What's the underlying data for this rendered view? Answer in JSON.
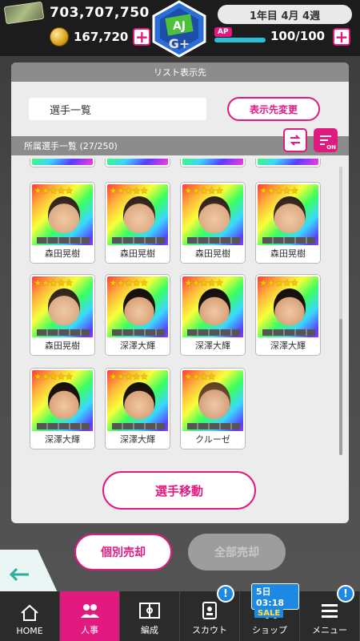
{
  "header": {
    "money": "703,707,750",
    "coins": "167,720",
    "date": "1年目 4月 4週",
    "ap_label": "AP",
    "ap_value": "100/100",
    "plus": "+"
  },
  "list_target": {
    "section_title": "リスト表示先",
    "current": "選手一覧",
    "change_button": "表示先変更"
  },
  "roster": {
    "section_title": "所属選手一覧 (27/250)",
    "filter_on": "ON",
    "cards": [
      {
        "name": "森田晃樹",
        "stars": "★★★★★",
        "face": "hair-long"
      },
      {
        "name": "森田晃樹",
        "stars": "★★★★★",
        "face": "hair-long"
      },
      {
        "name": "森田晃樹",
        "stars": "★★★★★",
        "face": "hair-long"
      },
      {
        "name": "森田晃樹",
        "stars": "★★★★★",
        "face": "hair-long"
      },
      {
        "name": "森田晃樹",
        "stars": "★★★★★",
        "face": "hair-long"
      },
      {
        "name": "深澤大輝",
        "stars": "★★★★★",
        "face": "hair-curly"
      },
      {
        "name": "深澤大輝",
        "stars": "★★★★★",
        "face": "hair-curly"
      },
      {
        "name": "深澤大輝",
        "stars": "★★★★★",
        "face": "hair-curly"
      },
      {
        "name": "深澤大輝",
        "stars": "★★★★★",
        "face": "hair-curly"
      },
      {
        "name": "深澤大輝",
        "stars": "★★★★★",
        "face": "hair-curly"
      },
      {
        "name": "クルーゼ",
        "stars": "★★★★",
        "face": "hair-foreign"
      }
    ],
    "move_button": "選手移動"
  },
  "actions": {
    "sell_individual": "個別売却",
    "sell_all": "全部売却"
  },
  "nav": {
    "items": [
      {
        "label": "HOME"
      },
      {
        "label": "人事"
      },
      {
        "label": "編成"
      },
      {
        "label": "スカウト"
      },
      {
        "label": "ショップ"
      },
      {
        "label": "メニュー"
      }
    ],
    "badge": "!",
    "shop_timer": "5日 03:18",
    "shop_sale": "SALE"
  },
  "colors": {
    "accent": "#e2197f",
    "badge": "#1e88e5"
  }
}
